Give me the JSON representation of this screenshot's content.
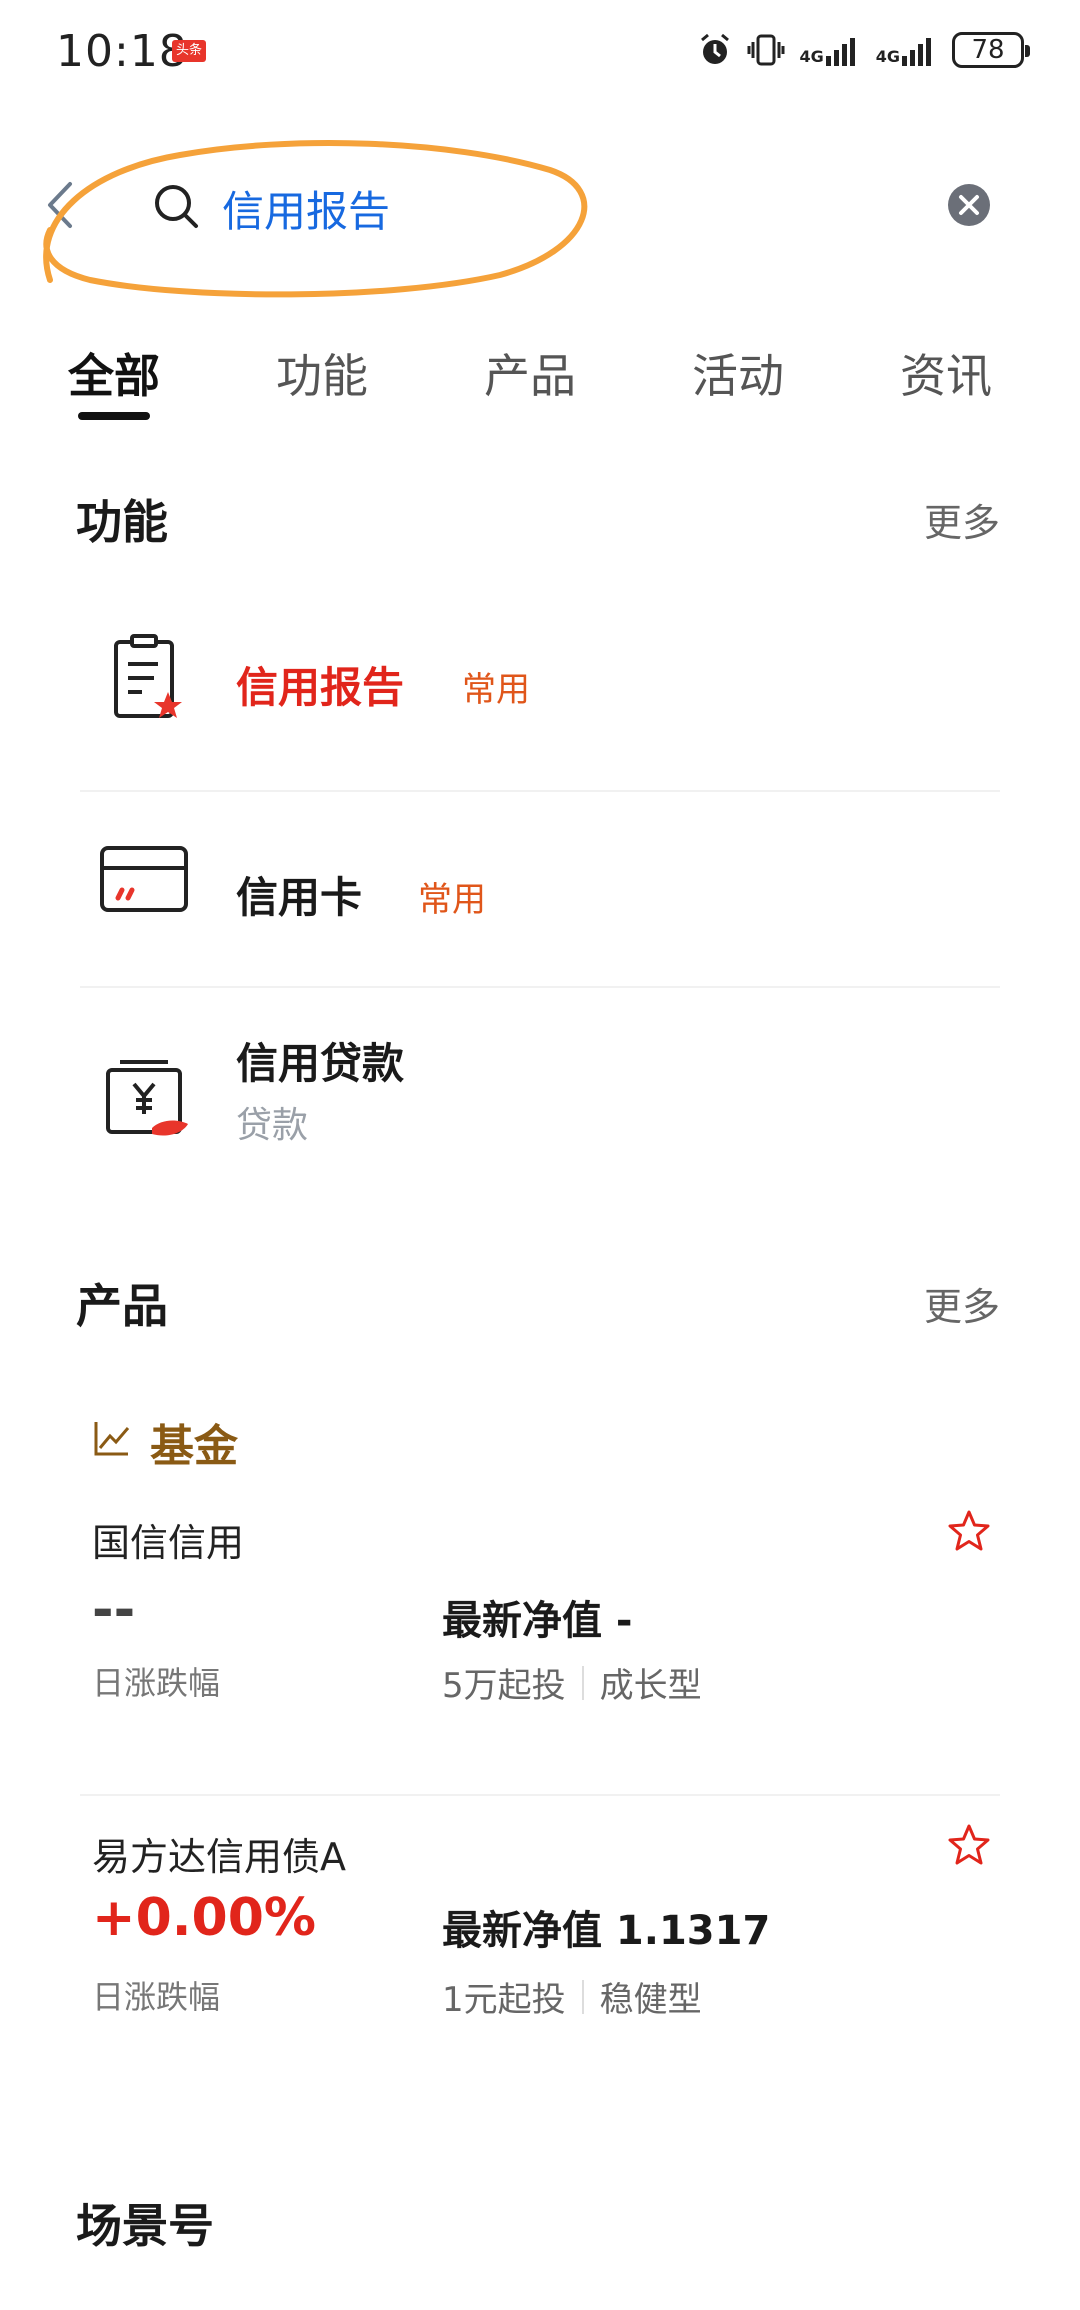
{
  "status_bar": {
    "time": "10:18",
    "badge": "头条",
    "network_1": "4G",
    "network_2": "4G",
    "battery": "78"
  },
  "search": {
    "query": "信用报告",
    "back_icon": "chevron-left-icon",
    "search_icon": "search-icon",
    "clear_icon": "clear-icon",
    "highlight_color": "#f5a23a"
  },
  "tabs": [
    {
      "label": "全部",
      "active": true
    },
    {
      "label": "功能",
      "active": false
    },
    {
      "label": "产品",
      "active": false
    },
    {
      "label": "活动",
      "active": false
    },
    {
      "label": "资讯",
      "active": false
    }
  ],
  "functions": {
    "title": "功能",
    "more": "更多",
    "items": [
      {
        "title": "信用报告",
        "tag": "常用",
        "icon": "credit-report-icon"
      },
      {
        "title": "信用卡",
        "tag": "常用",
        "icon": "credit-card-icon"
      },
      {
        "title": "信用贷款",
        "subtitle": "贷款",
        "icon": "loan-icon"
      }
    ]
  },
  "products": {
    "title": "产品",
    "more": "更多",
    "category": "基金",
    "category_icon": "trend-chart-icon",
    "funds": [
      {
        "name": "国信信用",
        "rate": "--",
        "rate_label": "日涨跌幅",
        "nav": "最新净值 -",
        "min_invest": "5万起投",
        "risk_type": "成长型"
      },
      {
        "name": "易方达信用债A",
        "rate": "+0.00%",
        "rate_label": "日涨跌幅",
        "nav": "最新净值 1.1317",
        "min_invest": "1元起投",
        "risk_type": "稳健型"
      }
    ]
  },
  "scenes": {
    "title": "场景号"
  },
  "colors": {
    "accent_blue": "#1769e0",
    "accent_red": "#e1251b",
    "tag_orange": "#e0561a",
    "fund_brown": "#8a5a14"
  }
}
